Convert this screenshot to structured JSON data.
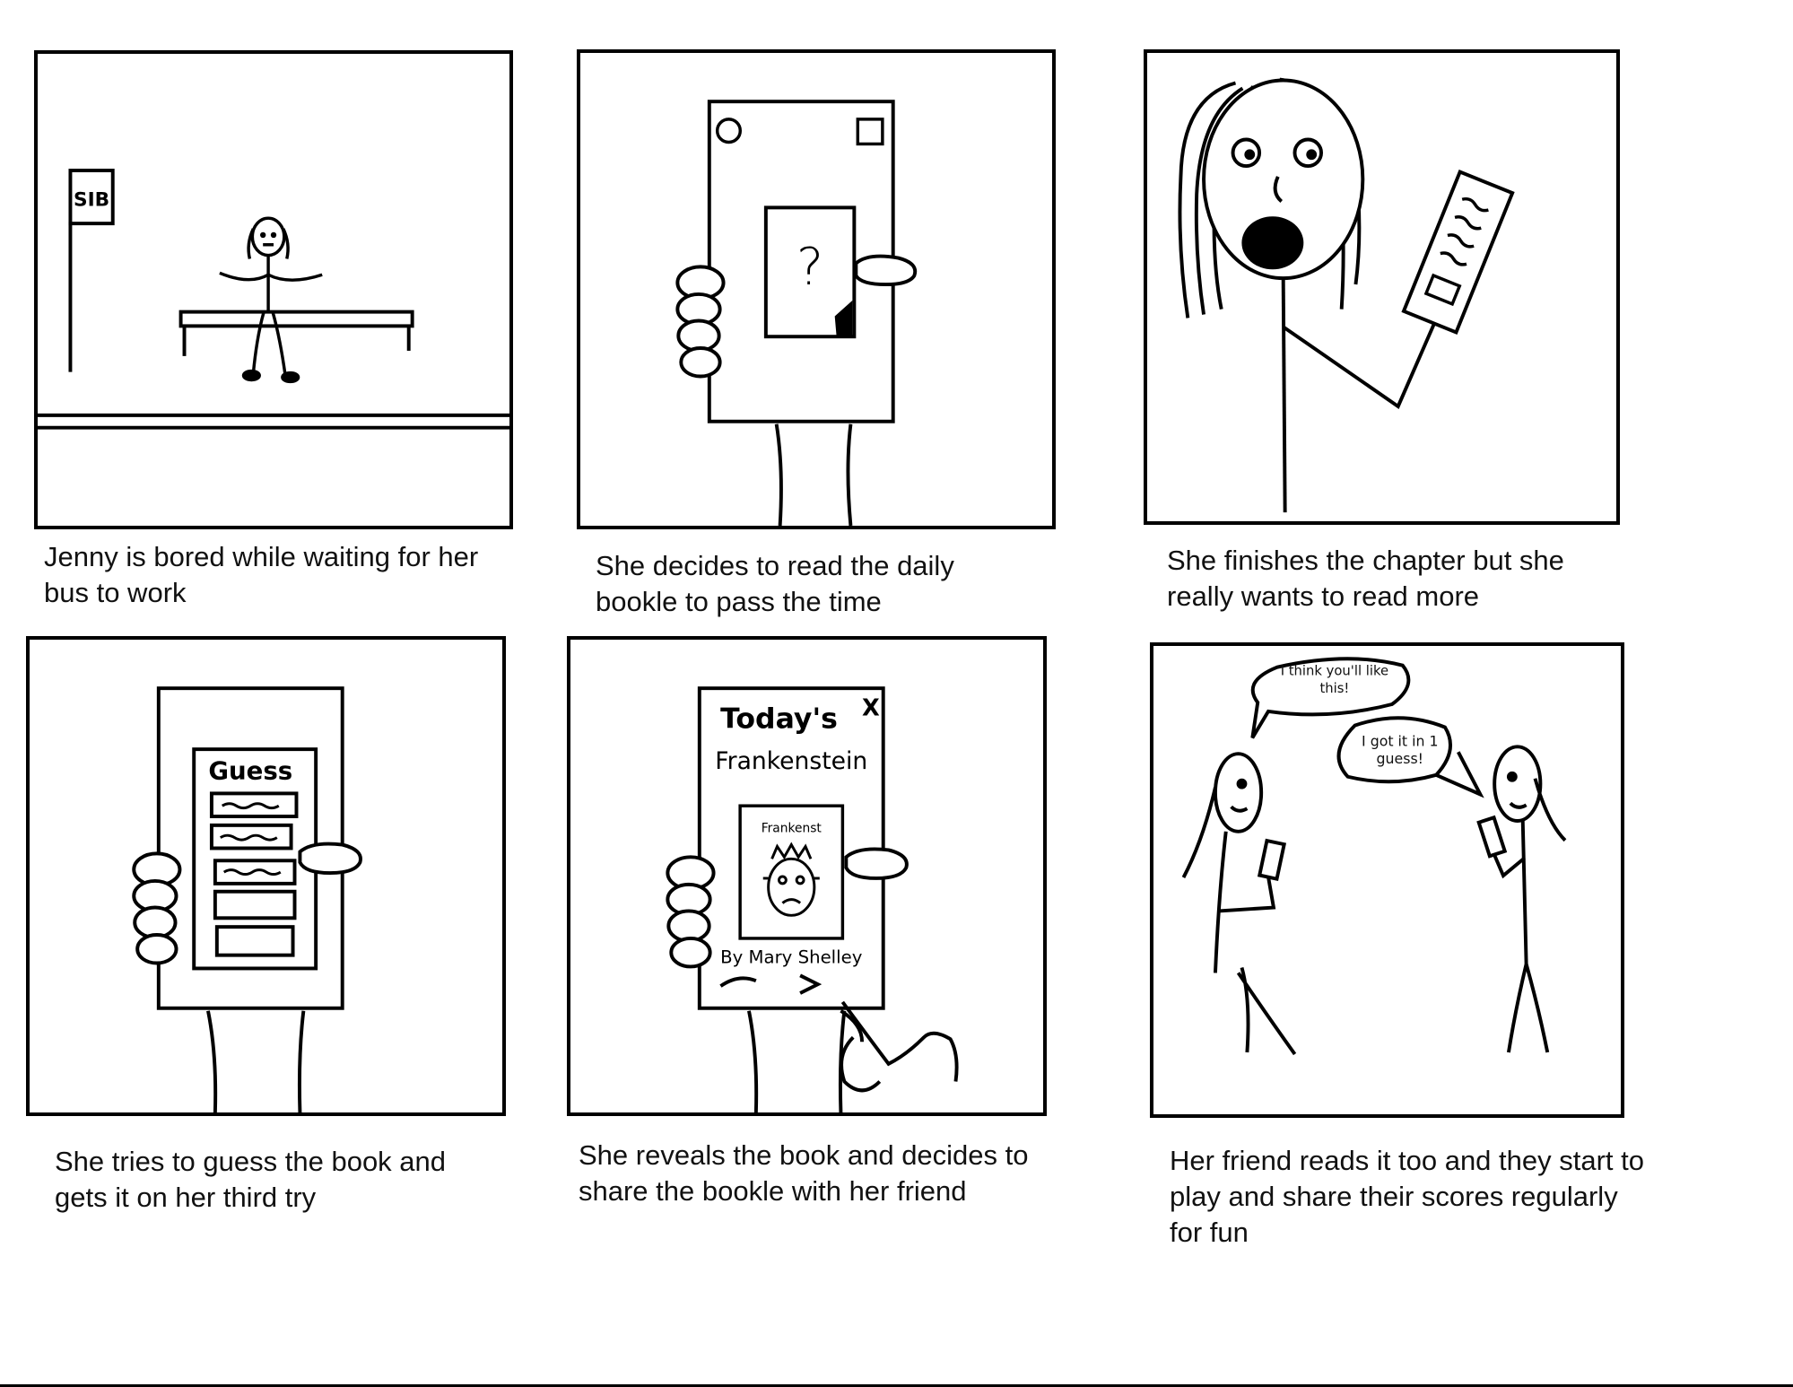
{
  "panels": [
    {
      "caption": "Jenny is bored while waiting for her bus to work",
      "bus_sign": "SIB"
    },
    {
      "caption": "She decides to read the daily bookle to pass the time",
      "screen_symbol": "?"
    },
    {
      "caption": "She finishes the chapter but she really wants to read more"
    },
    {
      "caption": "She tries to guess the book and gets it on her third try",
      "screen_title": "Guess"
    },
    {
      "caption": "She reveals the book and decides to share the bookle with her friend",
      "screen_title": "Today's",
      "close_mark": "X",
      "book_title": "Frankenstein",
      "cover_label": "Frankenst",
      "author_line": "By Mary Shelley"
    },
    {
      "caption": "Her friend reads it too and they start to play and share their scores regularly for fun",
      "bubble_left": "I think you'll like this!",
      "bubble_right": "I got it in 1 guess!"
    }
  ]
}
